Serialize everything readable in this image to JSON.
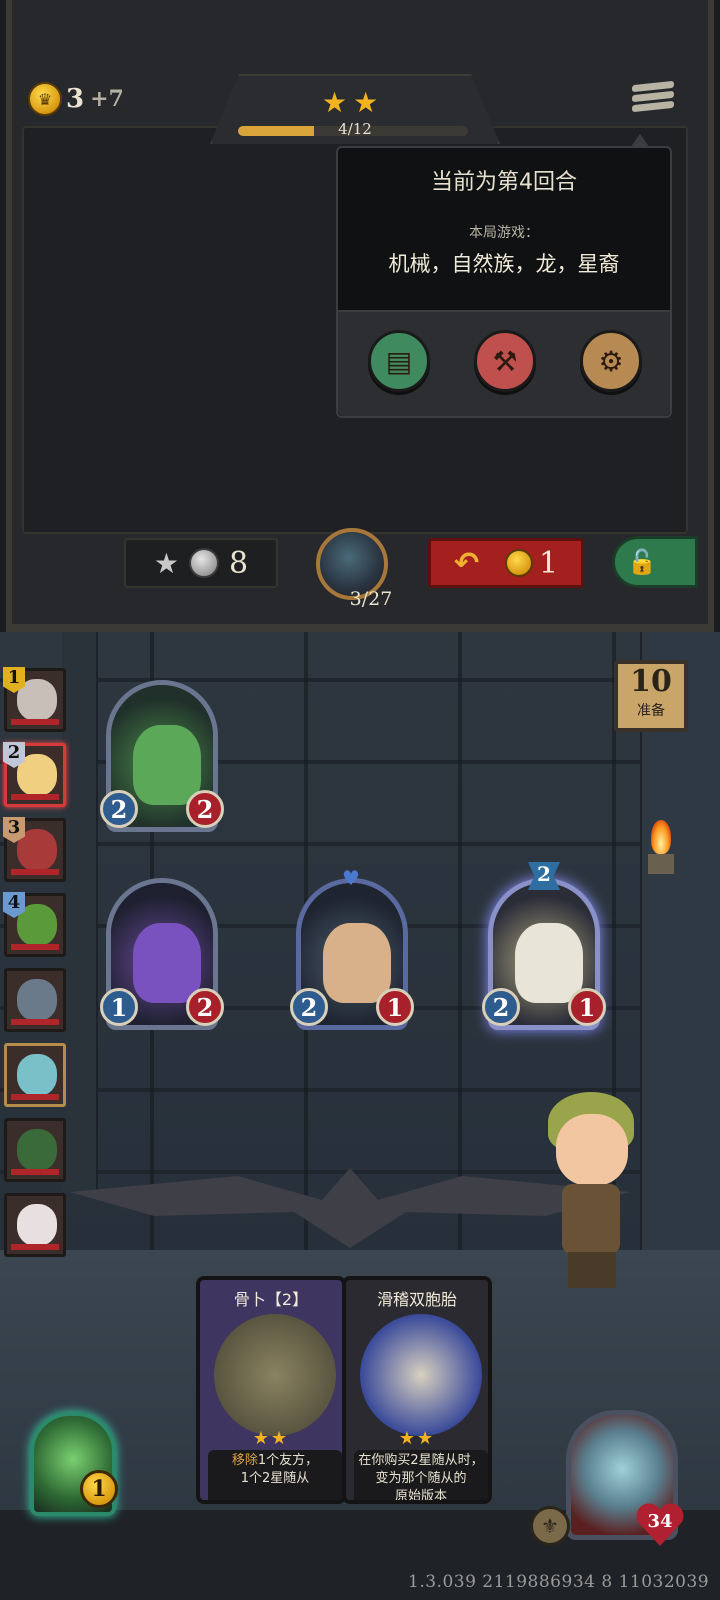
{
  "shop": {
    "gold": "3",
    "gold_income": "+7",
    "tavern_stars": "★★",
    "tier_progress_text": "4/12",
    "tier_progress_fraction": 0.33,
    "upgrade_cost": "8",
    "timer_text": "3/27",
    "refresh_cost": "1"
  },
  "popup": {
    "round_text": "当前为第4回合",
    "game_label": "本局游戏：",
    "tribes": "机械，自然族，龙，星裔",
    "icons": [
      "book-icon",
      "hammer-icon",
      "gear-icon"
    ]
  },
  "board": {
    "wave": {
      "number": "10",
      "label": "准备"
    },
    "minions": [
      {
        "name": "frog-dragon",
        "attack": "2",
        "health": "2"
      },
      {
        "name": "purple-dragon",
        "attack": "1",
        "health": "2"
      },
      {
        "name": "violinist",
        "attack": "2",
        "health": "1"
      },
      {
        "name": "priestess",
        "attack": "2",
        "health": "1",
        "tier": "2"
      }
    ]
  },
  "roster": [
    {
      "rank": "1"
    },
    {
      "rank": "2"
    },
    {
      "rank": "3"
    },
    {
      "rank": "4"
    },
    {
      "rank": ""
    },
    {
      "rank": ""
    },
    {
      "rank": ""
    },
    {
      "rank": ""
    }
  ],
  "hand": [
    {
      "title": "骨卜【2】",
      "stars": "★★",
      "desc_keyword": "移除",
      "desc_line1_rest": "1个友方，",
      "desc_line2": "1个2星随从"
    },
    {
      "title": "滑稽双胞胎",
      "stars": "★★",
      "desc_line1": "在你购买2星随从时，",
      "desc_line2": "变为那个随从的",
      "desc_line3": "原始版本"
    }
  ],
  "hud": {
    "spell_cost": "1",
    "hero_health": "34",
    "version": "1.3.039 2119886934 8 11032039"
  },
  "colors": {
    "gold": "#f3b320",
    "attack": "#2f5c8e",
    "health": "#a8202a",
    "refresh": "#a3201e",
    "lock": "#2f7a4d"
  }
}
